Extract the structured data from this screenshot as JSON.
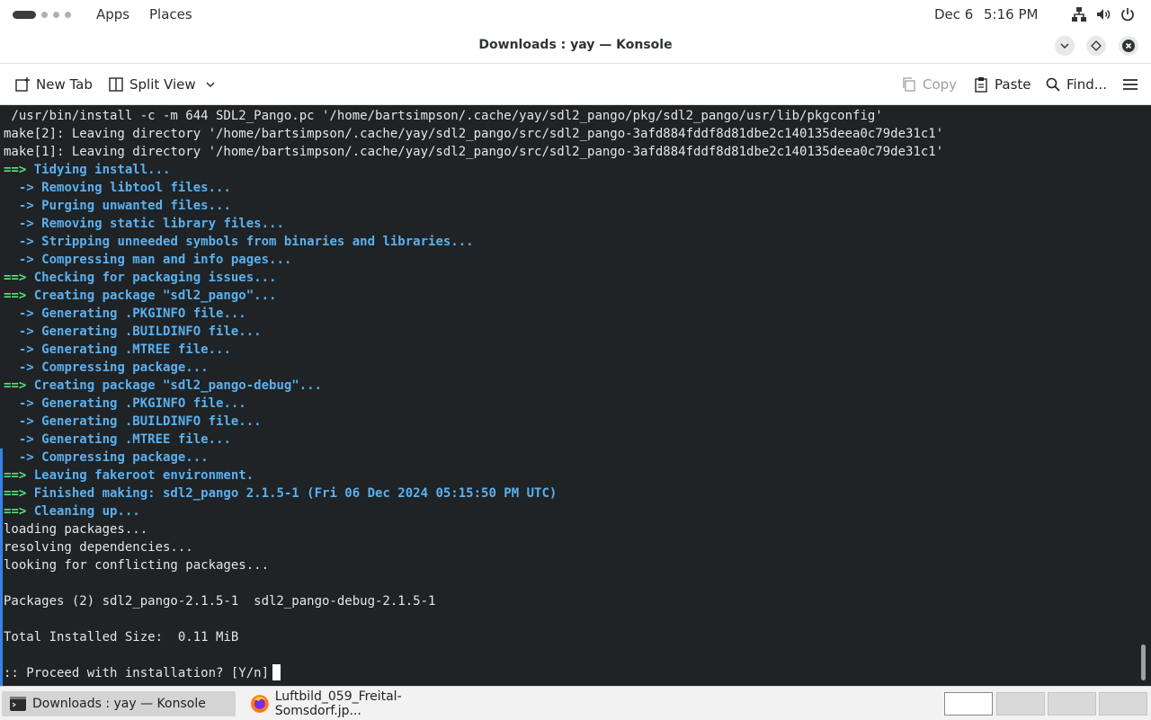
{
  "topbar": {
    "apps": "Apps",
    "places": "Places",
    "date": "Dec 6",
    "time": "5:16 PM"
  },
  "window": {
    "title": "Downloads : yay — Konsole"
  },
  "toolbar": {
    "new_tab": "New Tab",
    "split_view": "Split View",
    "copy": "Copy",
    "paste": "Paste",
    "find": "Find..."
  },
  "terminal": {
    "lines": [
      {
        "text": " /usr/bin/install -c -m 644 SDL2_Pango.pc '/home/bartsimpson/.cache/yay/sdl2_pango/pkg/sdl2_pango/usr/lib/pkgconfig'",
        "kind": "plain"
      },
      {
        "text": "make[2]: Leaving directory '/home/bartsimpson/.cache/yay/sdl2_pango/src/sdl2_pango-3afd884fddf8d81dbe2c140135deea0c79de31c1'",
        "kind": "plain"
      },
      {
        "text": "make[1]: Leaving directory '/home/bartsimpson/.cache/yay/sdl2_pango/src/sdl2_pango-3afd884fddf8d81dbe2c140135deea0c79de31c1'",
        "kind": "plain"
      },
      {
        "prefix": "==> ",
        "text": "Tidying install...",
        "kind": "main"
      },
      {
        "prefix": "  -> ",
        "text": "Removing libtool files...",
        "kind": "sub"
      },
      {
        "prefix": "  -> ",
        "text": "Purging unwanted files...",
        "kind": "sub"
      },
      {
        "prefix": "  -> ",
        "text": "Removing static library files...",
        "kind": "sub"
      },
      {
        "prefix": "  -> ",
        "text": "Stripping unneeded symbols from binaries and libraries...",
        "kind": "sub"
      },
      {
        "prefix": "  -> ",
        "text": "Compressing man and info pages...",
        "kind": "sub"
      },
      {
        "prefix": "==> ",
        "text": "Checking for packaging issues...",
        "kind": "main"
      },
      {
        "prefix": "==> ",
        "text": "Creating package \"sdl2_pango\"...",
        "kind": "main"
      },
      {
        "prefix": "  -> ",
        "text": "Generating .PKGINFO file...",
        "kind": "sub"
      },
      {
        "prefix": "  -> ",
        "text": "Generating .BUILDINFO file...",
        "kind": "sub"
      },
      {
        "prefix": "  -> ",
        "text": "Generating .MTREE file...",
        "kind": "sub"
      },
      {
        "prefix": "  -> ",
        "text": "Compressing package...",
        "kind": "sub"
      },
      {
        "prefix": "==> ",
        "text": "Creating package \"sdl2_pango-debug\"...",
        "kind": "main"
      },
      {
        "prefix": "  -> ",
        "text": "Generating .PKGINFO file...",
        "kind": "sub"
      },
      {
        "prefix": "  -> ",
        "text": "Generating .BUILDINFO file...",
        "kind": "sub"
      },
      {
        "prefix": "  -> ",
        "text": "Generating .MTREE file...",
        "kind": "sub"
      },
      {
        "prefix": "  -> ",
        "text": "Compressing package...",
        "kind": "sub"
      },
      {
        "prefix": "==> ",
        "text": "Leaving fakeroot environment.",
        "kind": "main"
      },
      {
        "prefix": "==> ",
        "text": "Finished making: sdl2_pango 2.1.5-1 (Fri 06 Dec 2024 05:15:50 PM UTC)",
        "kind": "main"
      },
      {
        "prefix": "==> ",
        "text": "Cleaning up...",
        "kind": "main"
      },
      {
        "text": "loading packages...",
        "kind": "plain"
      },
      {
        "text": "resolving dependencies...",
        "kind": "plain"
      },
      {
        "text": "looking for conflicting packages...",
        "kind": "plain"
      },
      {
        "text": "",
        "kind": "plain"
      },
      {
        "text": "Packages (2) sdl2_pango-2.1.5-1  sdl2_pango-debug-2.1.5-1",
        "kind": "plain"
      },
      {
        "text": "",
        "kind": "plain"
      },
      {
        "text": "Total Installed Size:  0.11 MiB",
        "kind": "plain"
      },
      {
        "text": "",
        "kind": "plain"
      },
      {
        "text": ":: Proceed with installation? [Y/n]",
        "kind": "prompt"
      }
    ]
  },
  "taskbar": {
    "tasks": [
      {
        "label": "Downloads : yay — Konsole",
        "icon": "terminal-icon",
        "active": true
      },
      {
        "label": "Luftbild_059_Freital-Somsdorf.jp...",
        "icon": "firefox-icon",
        "active": false
      }
    ],
    "workspaces": 4,
    "current_workspace": 1
  },
  "colors": {
    "terminal_bg": "#1f2325",
    "arrow_green": "#55e07a",
    "message_blue": "#5ab0f0",
    "accent": "#3584e4"
  }
}
